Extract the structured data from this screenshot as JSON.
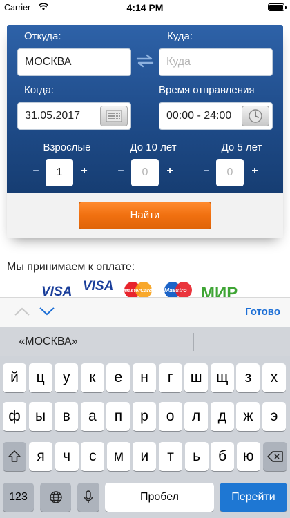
{
  "status_bar": {
    "carrier": "Carrier",
    "time": "4:14 PM"
  },
  "search": {
    "from_label": "Откуда:",
    "from_value": "МОСКВА",
    "to_label": "Куда:",
    "to_placeholder": "Куда",
    "when_label": "Когда:",
    "date_value": "31.05.2017",
    "time_label": "Время отправления",
    "time_value": "00:00 - 24:00",
    "passengers": [
      {
        "label": "Взрослые",
        "count": "1"
      },
      {
        "label": "До 10 лет",
        "count": "0"
      },
      {
        "label": "До 5 лет",
        "count": "0"
      }
    ],
    "minus_symbol": "−",
    "plus_symbol": "+",
    "find_button": "Найти"
  },
  "payment": {
    "title": "Мы принимаем к оплате:",
    "logos": [
      "VISA",
      "VISA",
      "MasterCard",
      "Maestro",
      "МИР"
    ]
  },
  "accessory": {
    "done": "Готово"
  },
  "keyboard": {
    "suggestion": "«МОСКВА»",
    "row1": [
      "й",
      "ц",
      "у",
      "к",
      "е",
      "н",
      "г",
      "ш",
      "щ",
      "з",
      "х"
    ],
    "row2": [
      "ф",
      "ы",
      "в",
      "а",
      "п",
      "р",
      "о",
      "л",
      "д",
      "ж",
      "э"
    ],
    "row3": [
      "я",
      "ч",
      "с",
      "м",
      "и",
      "т",
      "ь",
      "б",
      "ю"
    ],
    "numbers_key": "123",
    "space_key": "Пробел",
    "go_key": "Перейти"
  },
  "colors": {
    "panel_blue": "#1f4c8a",
    "button_orange": "#f07010",
    "done_blue": "#1d6fd6",
    "go_blue": "#1e77d3"
  }
}
